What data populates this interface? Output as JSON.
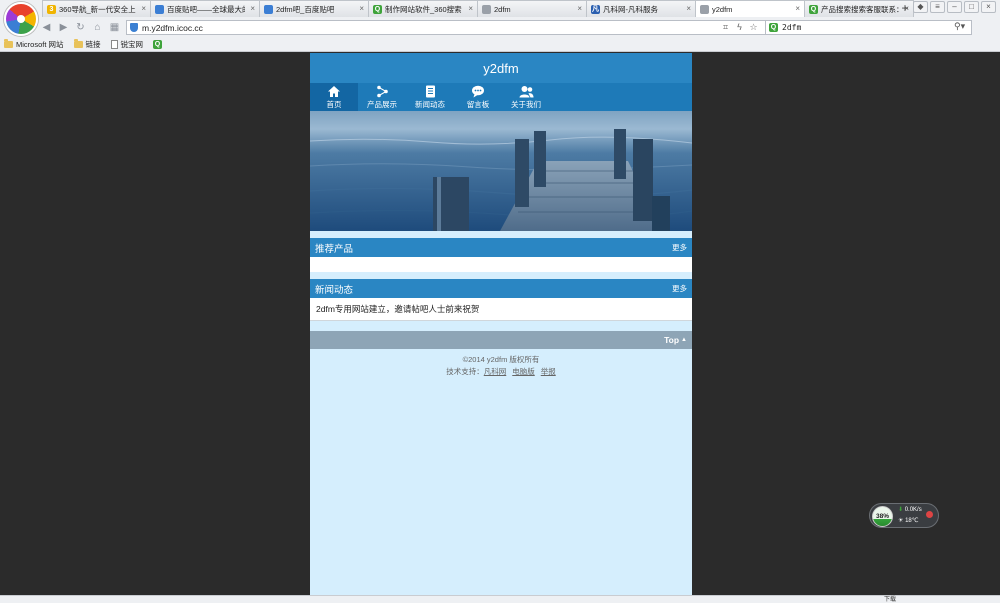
{
  "browser": {
    "tabs": [
      {
        "title": "360导航_新一代安全上网",
        "icon": "360-icon",
        "color": "#f0b400",
        "glyph": "3"
      },
      {
        "title": "百度贴吧——全球最大的",
        "icon": "page-icon",
        "color": "#3b7ed4",
        "glyph": ""
      },
      {
        "title": "2dfm吧_百度贴吧",
        "icon": "page-icon",
        "color": "#3b7ed4",
        "glyph": ""
      },
      {
        "title": "制作网站软件_360搜索",
        "icon": "search-icon",
        "color": "#3ea33a",
        "glyph": "Q"
      },
      {
        "title": "2dfm",
        "icon": "page-icon",
        "color": "#9aa0a8",
        "glyph": ""
      },
      {
        "title": "凡科网-凡科服务",
        "icon": "fanke-icon",
        "color": "#2a5fb0",
        "glyph": "凡"
      },
      {
        "title": "y2dfm",
        "icon": "page-icon",
        "color": "#9aa0a8",
        "glyph": ""
      },
      {
        "title": "产品搜索搜索客服联系：",
        "icon": "search-icon",
        "color": "#3ea33a",
        "glyph": "Q"
      }
    ],
    "active_tab": 6,
    "tab_close": "×",
    "new_tab": "+",
    "address": "m.y2dfm.icoc.cc",
    "search_text": "2dfm",
    "bookmarks": [
      {
        "label": "Microsoft 网站",
        "type": "folder"
      },
      {
        "label": "链接",
        "type": "folder"
      },
      {
        "label": "锐宝网",
        "type": "page"
      },
      {
        "label": "",
        "type": "green"
      }
    ],
    "status_download": "下载"
  },
  "site": {
    "title": "y2dfm",
    "nav": [
      {
        "label": "首页",
        "icon": "home-icon"
      },
      {
        "label": "产品展示",
        "icon": "share-icon"
      },
      {
        "label": "新闻动态",
        "icon": "document-icon"
      },
      {
        "label": "留言板",
        "icon": "chat-icon"
      },
      {
        "label": "关于我们",
        "icon": "users-icon"
      }
    ],
    "active_nav": 0,
    "sections": {
      "products": {
        "title": "推荐产品",
        "more": "更多"
      },
      "news": {
        "title": "新闻动态",
        "more": "更多",
        "items": [
          "2dfm专用网站建立，邀请帖吧人士前来祝贺"
        ]
      }
    },
    "top_label": "Top",
    "footer": {
      "copyright": "©2014 y2dfm 版权所有",
      "support_label": "技术支持：",
      "links": [
        "凡科网",
        "电脑版",
        "举报"
      ]
    }
  },
  "widget": {
    "percent": "38%",
    "speed": "0.0K/s",
    "temp": "18℃"
  },
  "colors": {
    "header_blue": "#2a86c3",
    "nav_blue": "#1e7ab8",
    "page_bg": "#d5eefd",
    "outer_bg": "#2b2b2b"
  }
}
